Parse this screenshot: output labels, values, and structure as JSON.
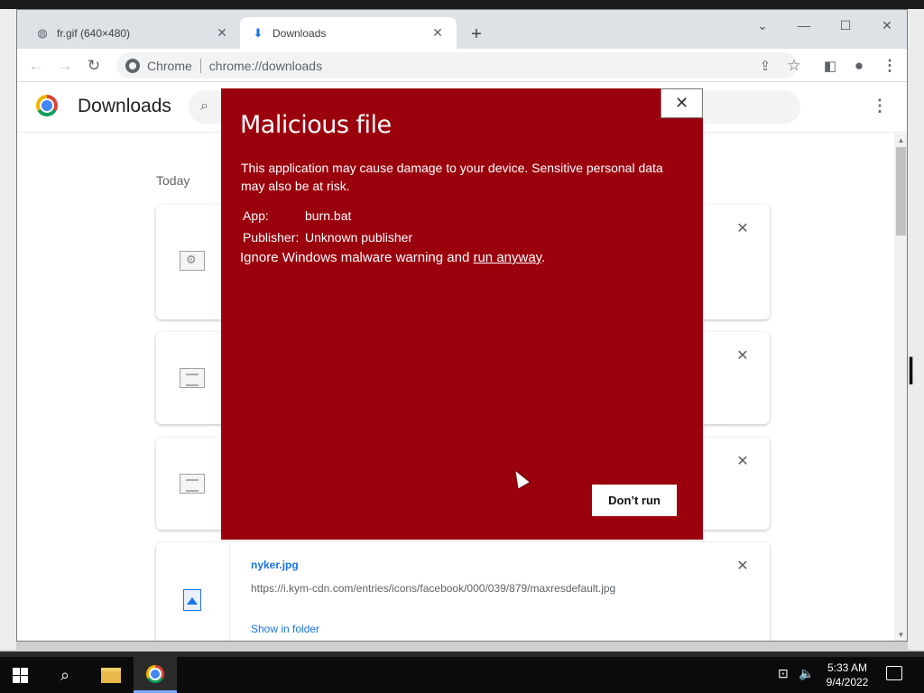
{
  "tabs": [
    {
      "label": "fr.gif (640×480)",
      "icon": "globe-icon"
    },
    {
      "label": "Downloads",
      "icon": "download-icon"
    }
  ],
  "omnibox": {
    "site": "Chrome",
    "url": "chrome://downloads"
  },
  "downloads_page": {
    "title": "Downloads",
    "section": "Today",
    "items": [
      {
        "name": "nyker.jpg",
        "url": "https://i.kym-cdn.com/entries/icons/facebook/000/039/879/maxresdefault.jpg",
        "action": "Show in folder"
      }
    ]
  },
  "dialog": {
    "title": "Malicious file",
    "message": "This application may cause damage to your device. Sensitive personal data may also be at risk.",
    "app_label": "App:",
    "app_value": "burn.bat",
    "publisher_label": "Publisher:",
    "publisher_value": "Unknown publisher",
    "ignore_prefix": "Ignore Windows malware warning and ",
    "ignore_link": "run anyway",
    "ignore_suffix": ".",
    "dont_run_label": "Don’t run",
    "bg_color": "#9b000d"
  },
  "taskbar": {
    "time": "5:33 AM",
    "date": "9/4/2022"
  }
}
